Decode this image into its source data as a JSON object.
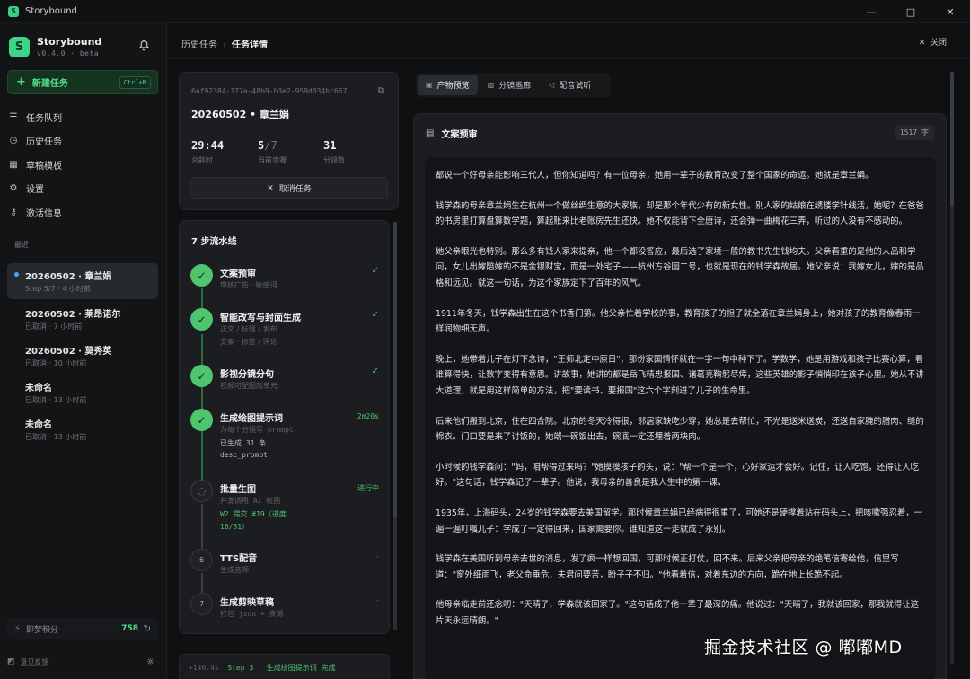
{
  "window": {
    "title": "Storybound",
    "logo_letter": "S",
    "controls": [
      "—",
      "□",
      "✕"
    ]
  },
  "sidebar": {
    "brand_name": "Storybound",
    "version": "v0.4.0 · beta",
    "new_task_label": "新建任务",
    "new_task_shortcut": "Ctrl+N",
    "nav": [
      {
        "label": "任务队列",
        "icon": "list-icon"
      },
      {
        "label": "历史任务",
        "icon": "history-icon"
      },
      {
        "label": "草稿模板",
        "icon": "template-icon"
      },
      {
        "label": "设置",
        "icon": "gear-icon"
      },
      {
        "label": "激活信息",
        "icon": "key-icon"
      }
    ],
    "recent_heading": "最近",
    "recent": [
      {
        "title": "20260502 · 章兰娟",
        "sub": "Step 5/7 · 4 小时前",
        "active": true
      },
      {
        "title": "20260502 · 莱昂诺尔",
        "sub": "已取消 · 7 小时前",
        "active": false
      },
      {
        "title": "20260502 · 莫秀英",
        "sub": "已取消 · 10 小时前",
        "active": false
      },
      {
        "title": "未命名",
        "sub": "已取消 · 13 小时前",
        "active": false
      },
      {
        "title": "未命名",
        "sub": "已取消 · 13 小时前",
        "active": false
      }
    ],
    "points_label": "即梦积分",
    "points_value": "758",
    "feedback_label": "意见反馈"
  },
  "header": {
    "crumb_parent": "历史任务",
    "crumb_current": "任务详情",
    "close_label": "关闭"
  },
  "task": {
    "id": "6af92384-177a-48b9-b3e2-959d034bc667",
    "title": "20260502 • 章兰娟",
    "elapsed": "29:44",
    "elapsed_label": "总耗时",
    "step_current": "5",
    "step_total": "/7",
    "step_label": "当前步骤",
    "shots": "31",
    "shots_label": "分镜数",
    "cancel_label": "取消任务"
  },
  "pipeline": {
    "title": "7 步流水线",
    "steps": [
      {
        "n": "1",
        "name": "文案预审",
        "sub": "审核广告 · 敏感词",
        "state": "done"
      },
      {
        "n": "2",
        "name": "智能改写与封面生成",
        "sub": "正文 / 标题 / 发布",
        "sub_b": "文案 · 标签 / 评论",
        "state": "done"
      },
      {
        "n": "3",
        "name": "影视分镜分句",
        "sub": "视频可配图的单元",
        "state": "done"
      },
      {
        "n": "4",
        "name": "生成绘图提示词",
        "sub": "为每个分镜写 prompt",
        "line2": "已生成 31 条",
        "line3": "desc_prompt",
        "time": "2m20s",
        "state": "done"
      },
      {
        "n": "5",
        "name": "批量生图",
        "sub": "并发调用 AI 绘画",
        "line2": "W2 提交 #19（进度",
        "line3": "16/31）",
        "status": "进行中",
        "state": "running"
      },
      {
        "n": "6",
        "name": "TTS配音",
        "sub": "生成音频",
        "state": "todo"
      },
      {
        "n": "7",
        "name": "生成剪映草稿",
        "sub": "打包 json + 资源",
        "state": "todo"
      }
    ],
    "log": [
      "+140.4s",
      "Step 3 · 生成绘图提示词 完成"
    ]
  },
  "tabs": [
    {
      "label": "产物预览",
      "icon": "box-icon",
      "active": true
    },
    {
      "label": "分镜画廊",
      "icon": "gallery-icon",
      "active": false
    },
    {
      "label": "配音试听",
      "icon": "speaker-icon",
      "active": false
    }
  ],
  "document": {
    "title": "文案预审",
    "char_count": "1517 字",
    "paragraphs": [
      "都说一个好母亲能影响三代人，但你知道吗？有一位母亲，她用一辈子的教育改变了整个国家的命运。她就是章兰娟。",
      "钱学森的母亲章兰娟生在杭州一个做丝绸生意的大家族，却是那个年代少有的新女性。别人家的姑娘在绣楼学针线活，她呢？在爸爸的书房里打算盘算数学题，算起账来比老账房先生还快。她不仅能背下全唐诗，还会弹一曲梅花三弄，听过的人没有不感动的。",
      "她父亲眼光也特别。那么多有钱人家来提亲，他一个都没答应，最后选了家境一般的教书先生钱均夫。父亲看重的是他的人品和学问，女儿出嫁陪嫁的不是金银财宝，而是一处宅子——杭州方谷园二号，也就是现在的钱学森故居。她父亲说：我嫁女儿，嫁的是品格和远见。就这一句话，为这个家族定下了百年的风气。",
      "1911年冬天，钱学森出生在这个书香门第。他父亲忙着学校的事，教育孩子的担子就全落在章兰娟身上，她对孩子的教育像春雨一样润物细无声。",
      "晚上，她带着儿子在灯下念诗，\"王师北定中原日\"，那份家国情怀就在一字一句中种下了。学数学，她是用游戏和孩子比赛心算，看谁算得快，让数字变得有意思。讲故事，她讲的都是岳飞精忠报国、诸葛亮鞠躬尽瘁，这些英雄的影子悄悄印在孩子心里。她从不讲大道理，就是用这样简单的方法，把\"要读书、要报国\"这六个字刻进了儿子的生命里。",
      "后来他们搬到北京，住在四合院。北京的冬天冷得很，邻居家缺吃少穿，她总是去帮忙，不光是送米送炭，还送自家腌的腊肉、缝的棉衣。门口要是来了讨饭的，她端一碗饭出去，碗底一定还埋着两块肉。",
      "小时候的钱学森问：\"妈，咱帮得过来吗？\"她摸摸孩子的头，说：\"帮一个是一个，心好家运才会好。记住，让人吃饱，还得让人吃好。\"这句话，钱学森记了一辈子。他说，我母亲的善良是我人生中的第一课。",
      "1935年，上海码头，24岁的钱学森要去美国留学。那时候章兰娟已经病得很重了，可她还是硬撑着站在码头上，把咳嗽强忍着，一遍一遍叮嘱儿子：学成了一定得回来，国家需要你。谁知道这一走就成了永别。",
      "钱学森在美国听到母亲去世的消息，发了疯一样想回国，可那时候正打仗，回不来。后来父亲把母亲的绝笔信寄给他，信里写道：\"窗外细雨飞，老父命垂危，夫君问要苦，盼子子不归。\"他看着信，对着东边的方向，跪在地上长跪不起。",
      "他母亲临走前还念叨：\"天晴了，学森就该回家了。\"这句话成了他一辈子最深的痛。他说过：\"天晴了，我就该回家，那我就得让这片天永远晴朗。\""
    ]
  },
  "watermark": "掘金技术社区 @ 嘟嘟MD"
}
